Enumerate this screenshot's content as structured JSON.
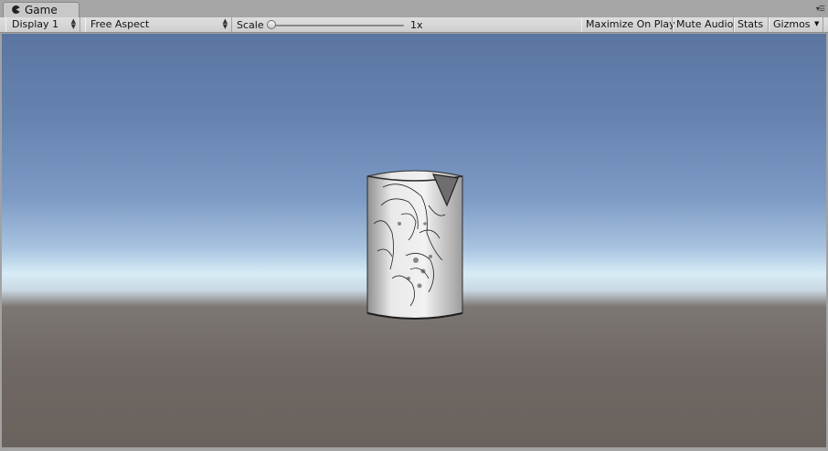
{
  "tab": {
    "label": "Game",
    "icon": "pacman-icon"
  },
  "toolbar": {
    "display": "Display 1",
    "aspect": "Free Aspect",
    "scale_label": "Scale",
    "scale_value": "1x",
    "maximize": "Maximize On Play",
    "mute": "Mute Audio",
    "stats": "Stats",
    "gizmos": "Gizmos"
  },
  "scene": {
    "sky_top": "#5a75a0",
    "horizon": "#d7ecf7",
    "ground": "#6f6864"
  }
}
